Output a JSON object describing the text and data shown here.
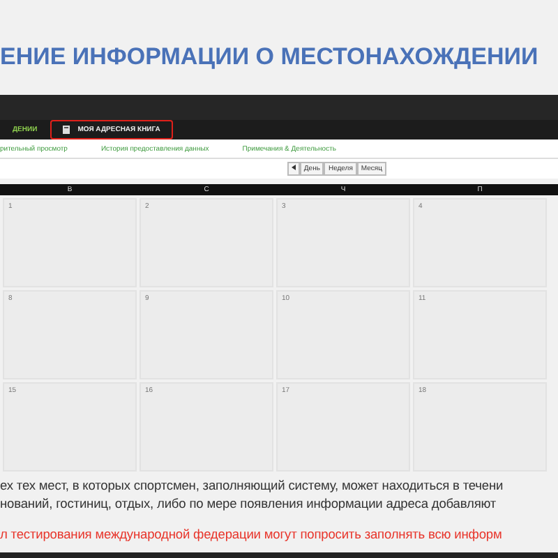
{
  "slide_title": "ЕНИЕ ИНФОРМАЦИИ О МЕСТОНАХОЖДЕНИИ",
  "nav_tabs": [
    {
      "label": "ДЕНИИ",
      "selected": true,
      "highlighted": false
    },
    {
      "label": "МОЯ АДРЕСНАЯ КНИГА",
      "selected": false,
      "highlighted": true
    }
  ],
  "sub_tabs": [
    "рительный просмотр",
    "История предоставления данных",
    "Примечания & Деятельность"
  ],
  "view_buttons": [
    "День",
    "Неделя",
    "Месяц"
  ],
  "calendar": {
    "weekdays": [
      "В",
      "С",
      "Ч",
      "П"
    ],
    "weeks": [
      [
        "1",
        "2",
        "3",
        "4"
      ],
      [
        "8",
        "9",
        "10",
        "11"
      ],
      [
        "15",
        "16",
        "17",
        "18"
      ]
    ]
  },
  "notes": [
    {
      "text": "ех тех мест, в которых спортсмен, заполняющий систему, может находиться в течени",
      "kind": "normal"
    },
    {
      "text": "нований, гостиниц, отдых, либо по мере появления информации адреса добавляют",
      "kind": "normal"
    },
    {
      "text": "л тестирования международной федерации могут попросить заполнять всю информ",
      "kind": "warning"
    }
  ]
}
